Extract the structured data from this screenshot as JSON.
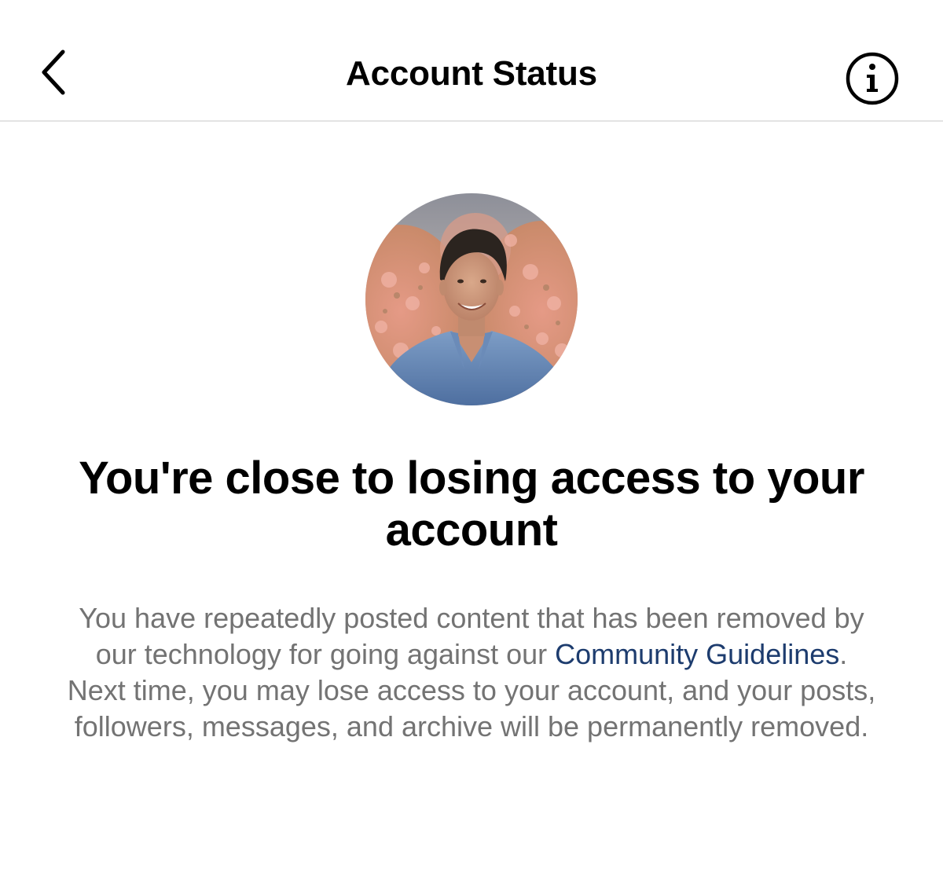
{
  "header": {
    "title": "Account Status",
    "back_icon": "chevron-left-icon",
    "info_icon": "info-circle-icon"
  },
  "profile": {
    "avatar": "profile-photo"
  },
  "warning": {
    "headline": "You're close to losing access to your account",
    "body_before_link": "You have repeatedly posted content that has been removed by our technology for going against our ",
    "link_text": "Community Guidelines",
    "body_after_link": ". Next time, you may lose access to your account, and your posts, followers, messages, and archive will be permanently removed."
  },
  "colors": {
    "text": "#000000",
    "secondary_text": "#737373",
    "link": "#1d3c6e",
    "divider": "#e3e3e3",
    "background": "#ffffff"
  }
}
